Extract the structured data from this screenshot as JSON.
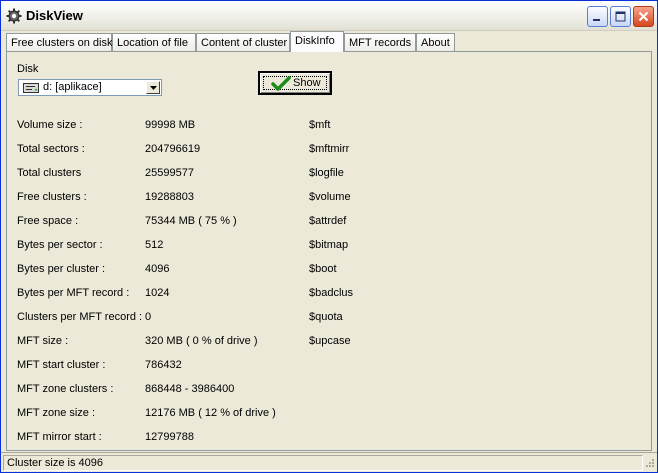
{
  "window": {
    "title": "DiskView"
  },
  "tabs": [
    {
      "label": "Free clusters on disk"
    },
    {
      "label": "Location of file"
    },
    {
      "label": "Content of cluster"
    },
    {
      "label": "DiskInfo",
      "active": true
    },
    {
      "label": "MFT records"
    },
    {
      "label": "About"
    }
  ],
  "disk": {
    "label": "Disk",
    "selected": "d: [aplikace]"
  },
  "show_button": {
    "label": "Show"
  },
  "info": [
    {
      "label": "Volume size :",
      "value": "99998 MB"
    },
    {
      "label": "Total sectors :",
      "value": "204796619"
    },
    {
      "label": "Total clusters",
      "value": "25599577"
    },
    {
      "label": "Free clusters :",
      "value": "19288803"
    },
    {
      "label": "Free space :",
      "value": "75344 MB ( 75 % )"
    },
    {
      "label": "Bytes per sector :",
      "value": "512"
    },
    {
      "label": "Bytes per cluster :",
      "value": "4096"
    },
    {
      "label": "Bytes per MFT record :",
      "value": "1024"
    },
    {
      "label": "Clusters per MFT record :",
      "value": "0"
    },
    {
      "label": "MFT size :",
      "value": "320 MB ( 0 % of drive )"
    },
    {
      "label": "MFT start cluster :",
      "value": "786432"
    },
    {
      "label": "MFT zone clusters :",
      "value": "868448 - 3986400"
    },
    {
      "label": "MFT zone size :",
      "value": "12176 MB ( 12 % of drive )"
    },
    {
      "label": "MFT mirror start :",
      "value": "12799788"
    }
  ],
  "mft_files": [
    "$mft",
    "$mftmirr",
    "$logfile",
    "$volume",
    "$attrdef",
    "$bitmap",
    "$boot",
    "$badclus",
    "$quota",
    "$upcase"
  ],
  "status": {
    "text": "Cluster size is 4096"
  },
  "colors": {
    "window_bg": "#ece9d8",
    "accent": "#0831d9",
    "close_button": "#d6461f",
    "check_icon": "#1a8c1a"
  },
  "icons": [
    "gear-icon",
    "minimize-icon",
    "maximize-icon",
    "close-icon",
    "drive-icon",
    "dropdown-arrow-icon",
    "checkmark-icon",
    "size-grip-icon"
  ]
}
